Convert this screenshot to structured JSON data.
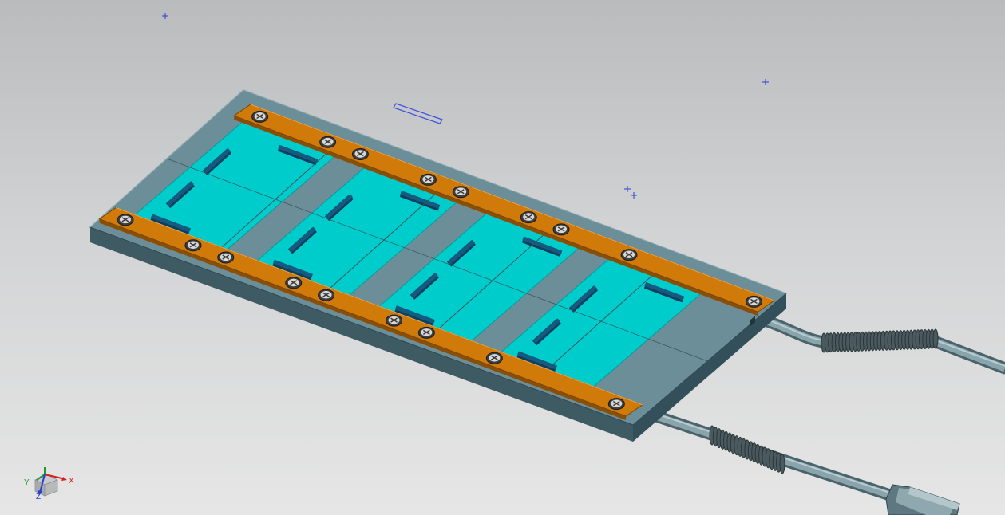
{
  "viewport": {
    "background_top": "#b9bbbd",
    "background_bottom": "#e6e6e6"
  },
  "model": {
    "plate_color": "#6c8e98",
    "plate_side_color": "#3e5a63",
    "board_color": "#00cccc",
    "clamp_bar_color": "#d07a0a",
    "connector_color": "#155a80",
    "cable_color": "#78939b",
    "board_count": 4,
    "screw_count": 18
  },
  "markers": {
    "datum_plus_count": 4,
    "datum_color": "#2a3cd6"
  },
  "triad": {
    "x_label": "X",
    "y_label": "Y",
    "z_label": "Z",
    "x_color": "#d42020",
    "y_color": "#1f9a2a",
    "z_color": "#2a3cd6"
  }
}
